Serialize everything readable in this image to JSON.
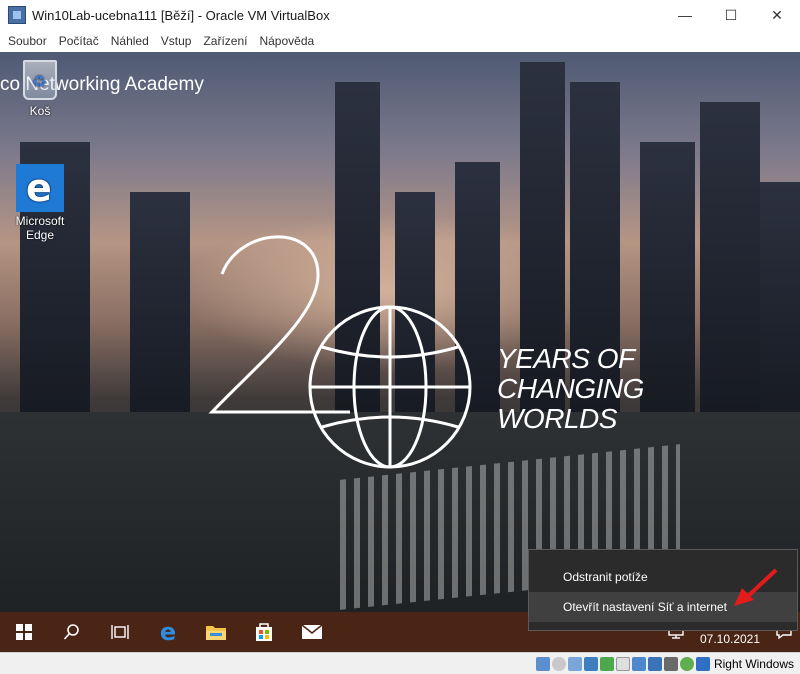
{
  "window": {
    "title": "Win10Lab-ucebna111 [Běží] - Oracle VM VirtualBox",
    "minimize_glyph": "—",
    "maximize_glyph": "☐",
    "close_glyph": "✕"
  },
  "menu": [
    "Soubor",
    "Počítač",
    "Náhled",
    "Vstup",
    "Zařízení",
    "Nápověda"
  ],
  "desktop": {
    "heading": "co Networking Academy",
    "icons": [
      {
        "label": "Koš",
        "icon": "recycle-bin-icon"
      },
      {
        "label": "Microsoft Edge",
        "icon": "edge-icon"
      }
    ],
    "wallpaper": {
      "tagline": [
        "YEARS OF",
        "CHANGING",
        "WORLDS"
      ]
    }
  },
  "context_menu": {
    "items": [
      "Odstranit potíže",
      "Otevřít nastavení Síť a internet"
    ],
    "highlighted_index": 1,
    "annotation_color": "#e31b1b"
  },
  "taskbar": {
    "color": "#4a2414",
    "apps": [
      "start-icon",
      "search-icon",
      "task-view-icon",
      "edge-icon",
      "file-explorer-icon",
      "store-icon",
      "mail-icon"
    ],
    "date": "07.10.2021"
  },
  "statusbar": {
    "host_key": "Right Windows",
    "indicators": [
      "hard-disk-icon",
      "optical-drive-icon",
      "audio-icon",
      "network-icon",
      "usb-icon",
      "shared-folders-icon",
      "display-icon",
      "video-capture-icon",
      "cpu-icon",
      "mouse-integration-icon",
      "download-icon"
    ]
  }
}
